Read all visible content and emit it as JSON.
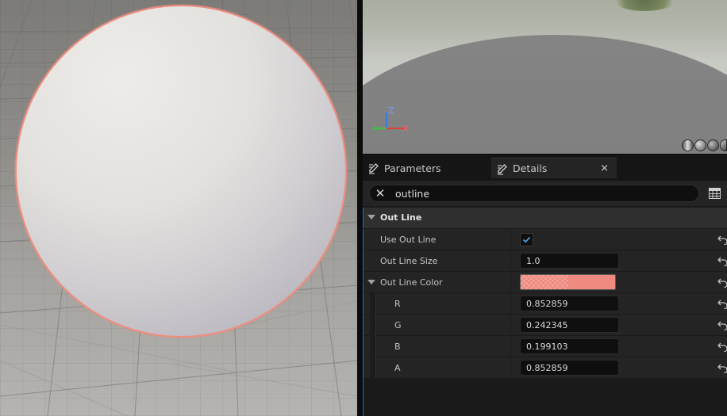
{
  "colors": {
    "outline": "#ee8e80",
    "outline_color_value": "#ef8a80",
    "accent": "#1e6fbf",
    "checkbox_check": "#4a9ee8"
  },
  "preview": {
    "axis_z": "Z",
    "axis_x": "X"
  },
  "tabs": [
    {
      "label": "Parameters",
      "icon": "edit-pencil-icon"
    },
    {
      "label": "Details",
      "icon": "edit-pencil-icon",
      "close": "×"
    }
  ],
  "search": {
    "value": "outline",
    "clear_icon": "close-icon"
  },
  "section": {
    "title": "Out Line"
  },
  "rows": {
    "use_out_line": {
      "label": "Use Out Line",
      "checked": true
    },
    "out_line_size": {
      "label": "Out Line Size",
      "value": "1.0"
    },
    "out_line_color": {
      "label": "Out Line Color"
    },
    "r": {
      "label": "R",
      "value": "0.852859"
    },
    "g": {
      "label": "G",
      "value": "0.242345"
    },
    "b": {
      "label": "B",
      "value": "0.199103"
    },
    "a": {
      "label": "A",
      "value": "0.852859"
    }
  }
}
